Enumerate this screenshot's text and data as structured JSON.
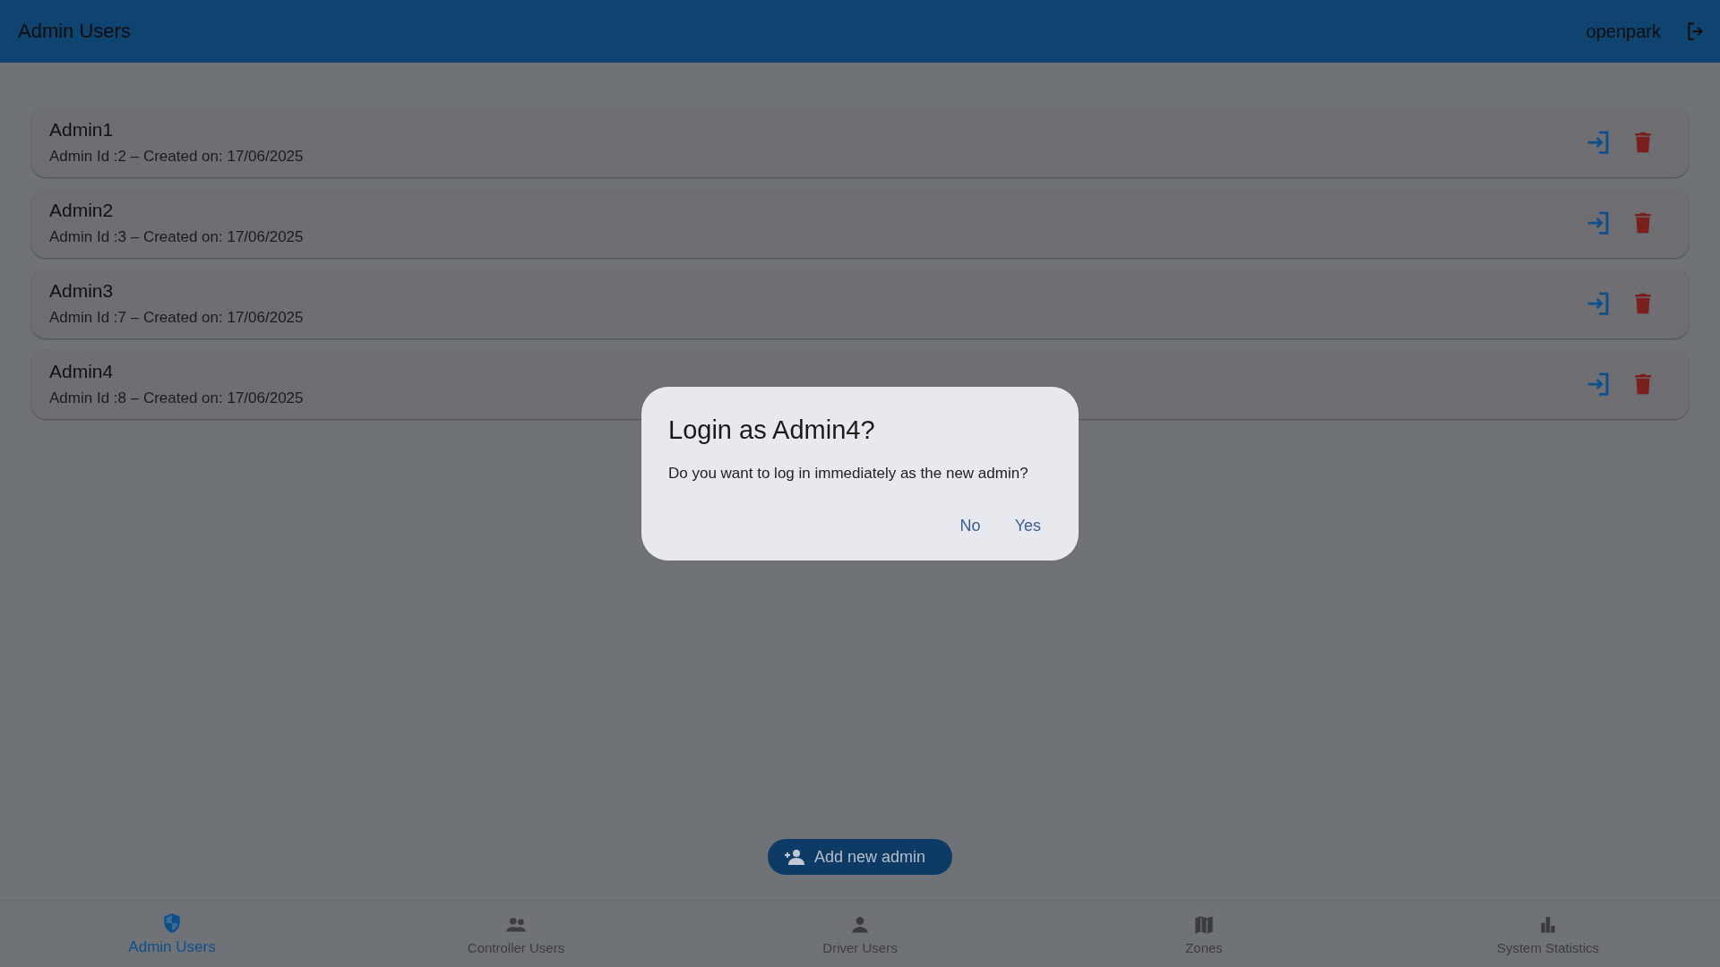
{
  "app_bar": {
    "title": "Admin Users",
    "user": "openpark"
  },
  "admins": [
    {
      "name": "Admin1",
      "details": "Admin Id :2 – Created on: 17/06/2025"
    },
    {
      "name": "Admin2",
      "details": "Admin Id :3 – Created on: 17/06/2025"
    },
    {
      "name": "Admin3",
      "details": "Admin Id :7 – Created on: 17/06/2025"
    },
    {
      "name": "Admin4",
      "details": "Admin Id :8 – Created on: 17/06/2025"
    }
  ],
  "add_button": {
    "label": "Add new admin"
  },
  "dialog": {
    "title": "Login as Admin4?",
    "message": "Do you want to log in immediately as the new admin?",
    "buttons": [
      "No",
      "Yes"
    ]
  },
  "nav": [
    {
      "kind": "shield",
      "label": "Admin Users",
      "selected": true
    },
    {
      "kind": "group",
      "label": "Controller Users",
      "selected": false
    },
    {
      "kind": "person",
      "label": "Driver Users",
      "selected": false
    },
    {
      "kind": "map",
      "label": "Zones",
      "selected": false
    },
    {
      "kind": "chart",
      "label": "System Statistics",
      "selected": false
    }
  ]
}
